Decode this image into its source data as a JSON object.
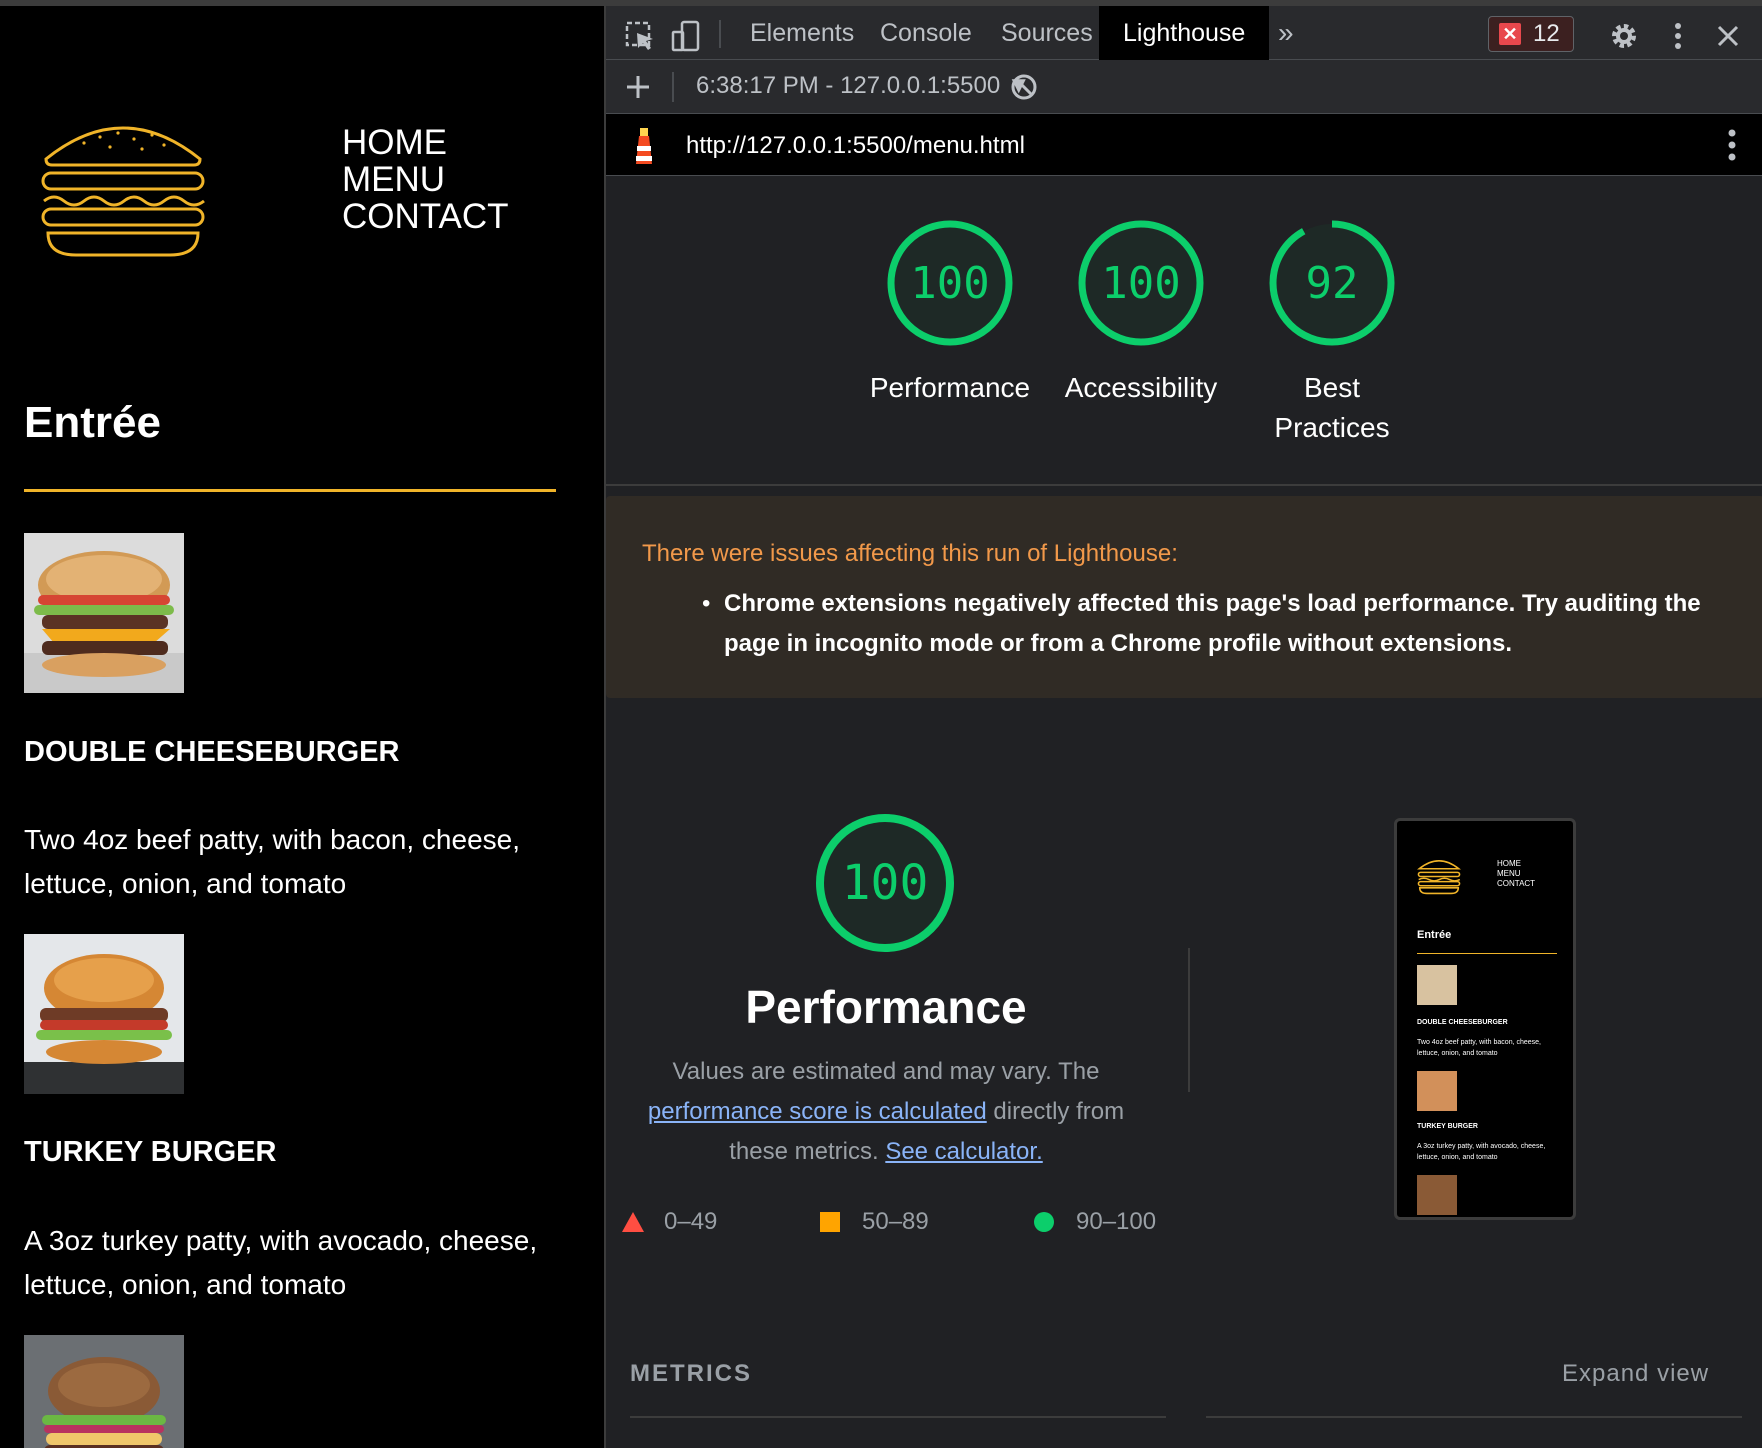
{
  "site": {
    "nav": [
      "HOME",
      "MENU",
      "CONTACT"
    ],
    "section_title": "Entrée",
    "items": [
      {
        "name": "DOUBLE CHEESEBURGER",
        "desc": "Two 4oz beef patty, with bacon, cheese, lettuce, onion, and tomato"
      },
      {
        "name": "TURKEY BURGER",
        "desc": "A 3oz turkey patty, with avocado, cheese, lettuce, onion, and tomato"
      }
    ],
    "accent_color": "#f0b429"
  },
  "devtools": {
    "tabs": [
      "Elements",
      "Console",
      "Sources",
      "Lighthouse"
    ],
    "active_tab": "Lighthouse",
    "more_tabs": "»",
    "error_count": "12",
    "report_selector": "6:38:17 PM - 127.0.0.1:5500 ▼",
    "url": "http://127.0.0.1:5500/menu.html"
  },
  "scores": [
    {
      "label": "Performance",
      "value": "100",
      "fraction": 1.0
    },
    {
      "label": "Accessibility",
      "value": "100",
      "fraction": 1.0
    },
    {
      "label": "Best Practices",
      "value": "92",
      "fraction": 0.92
    }
  ],
  "warning": {
    "title": "There were issues affecting this run of Lighthouse:",
    "item": "Chrome extensions negatively affected this page's load performance. Try auditing the page in incognito mode or from a Chrome profile without extensions."
  },
  "performance": {
    "score": "100",
    "title": "Performance",
    "desc_pre": "Values are estimated and may vary. The",
    "link1": "performance score is calculated",
    "desc_mid": "directly from these metrics.",
    "link2": "See calculator."
  },
  "legend": [
    {
      "range": "0–49",
      "color": "#ff4e42"
    },
    {
      "range": "50–89",
      "color": "#ffa400"
    },
    {
      "range": "90–100",
      "color": "#0cce6b"
    }
  ],
  "thumbnail": {
    "nav": [
      "HOME",
      "MENU",
      "CONTACT"
    ],
    "title": "Entrée",
    "items": [
      {
        "name": "DOUBLE CHEESEBURGER",
        "desc": "Two 4oz beef patty, with bacon, cheese, lettuce, onion, and tomato"
      },
      {
        "name": "TURKEY BURGER",
        "desc": "A 3oz turkey patty, with avocado, cheese, lettuce, onion, and tomato"
      }
    ]
  },
  "metrics": {
    "label": "METRICS",
    "expand": "Expand view"
  },
  "colors": {
    "pass": "#0cce6b",
    "warn_text": "#f2994a",
    "link": "#8ab4f8"
  }
}
